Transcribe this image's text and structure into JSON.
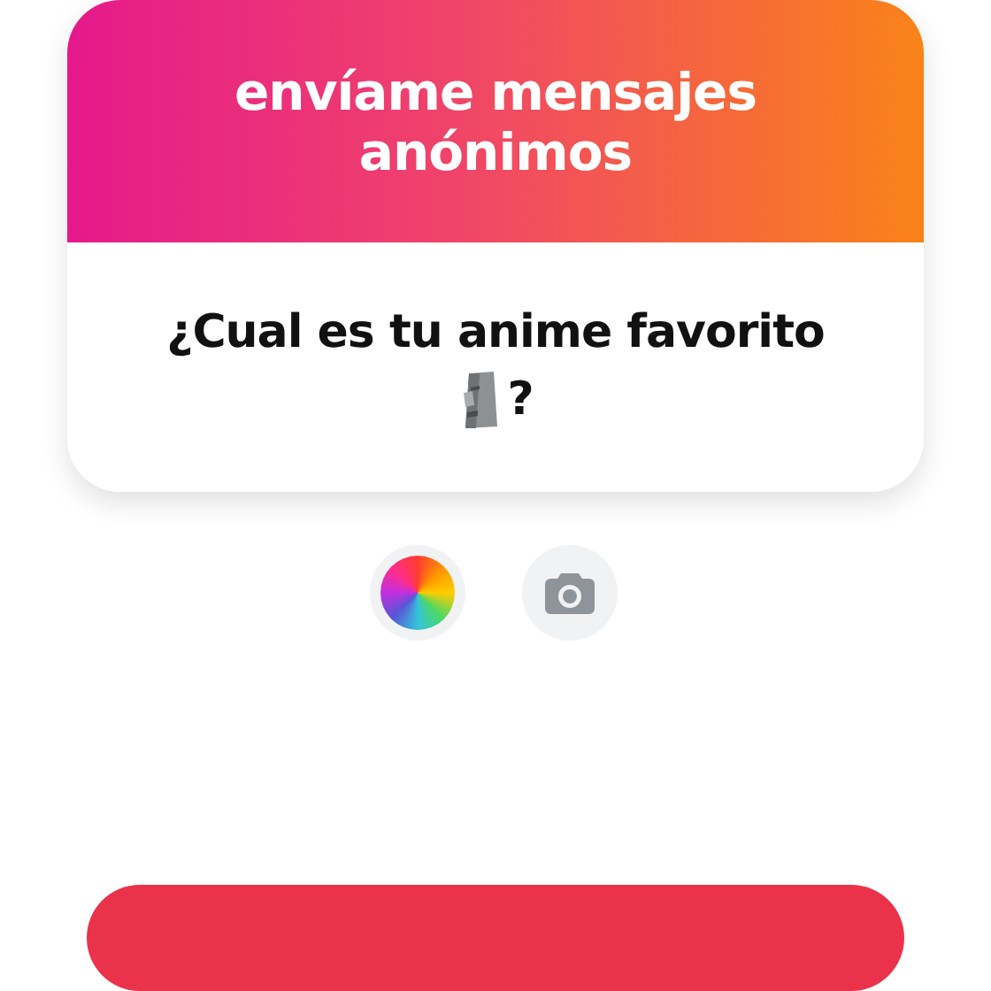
{
  "card": {
    "title": "envíame mensajes anónimos",
    "question": {
      "text": "¿Cual es tu anime favorito",
      "after_emoji": "?"
    }
  },
  "tools": [
    {
      "kind": "color"
    },
    {
      "kind": "camera"
    }
  ]
}
